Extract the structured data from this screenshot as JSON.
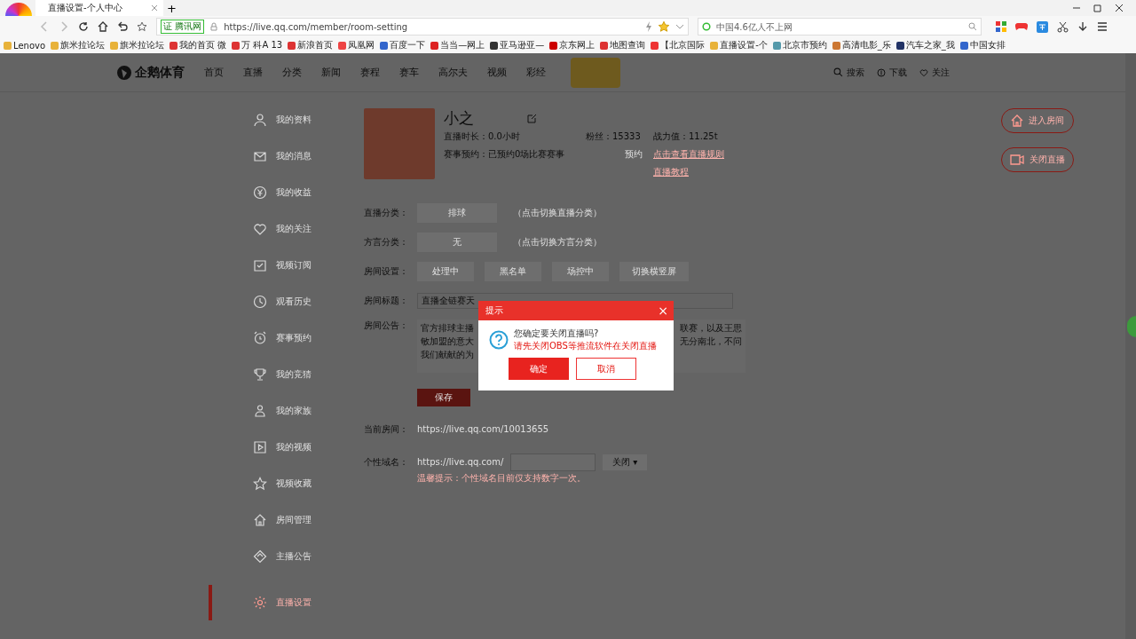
{
  "browser": {
    "tab": {
      "title": "直播设置-个人中心",
      "selected": true
    },
    "new_tab": "+",
    "badge": "证 腾讯网",
    "url": "https://live.qq.com/member/room-setting",
    "search_placeholder": "中国4.6亿人不上网",
    "bookmarks": [
      "Lenovo",
      "旗米拉论坛",
      "旗米拉论坛",
      "我的首页 微",
      "万 科A 13",
      "新浪首页",
      "凤凰网",
      "百度一下",
      "当当—网上",
      "亚马逊亚—",
      "京东网上",
      "地图查询",
      "【北京国际",
      "直播设置-个",
      "北京市预约",
      "高清电影_乐",
      "汽车之家_我",
      "中国女排"
    ]
  },
  "header": {
    "logo": "企鹅体育",
    "nav": [
      "首页",
      "直播",
      "分类",
      "新闻",
      "赛程",
      "赛车",
      "高尔夫",
      "视频",
      "彩经"
    ],
    "search": "搜索",
    "download": "下载",
    "follow": "关注"
  },
  "sidebar": [
    {
      "label": "我的资料",
      "selected": false
    },
    {
      "label": "我的消息",
      "selected": false
    },
    {
      "label": "我的收益",
      "selected": false
    },
    {
      "label": "我的关注",
      "selected": false
    },
    {
      "label": "视频订阅",
      "selected": false
    },
    {
      "label": "观看历史",
      "selected": false
    },
    {
      "label": "赛事预约",
      "selected": false
    },
    {
      "label": "我的竞猜",
      "selected": false
    },
    {
      "label": "我的家族",
      "selected": false
    },
    {
      "label": "我的视频",
      "selected": false
    },
    {
      "label": "视频收藏",
      "selected": false
    },
    {
      "label": "房间管理",
      "selected": false
    },
    {
      "label": "主播公告",
      "selected": false
    },
    {
      "label": "直播设置",
      "selected": true
    }
  ],
  "profile": {
    "name": "小之",
    "duration": "直播时长：0.0小时",
    "fans": "粉丝：15333",
    "power": "战力值：11.25t",
    "booking": "赛事预约：已预约0场比赛赛事",
    "booking_link": "预约",
    "rules_link": "点击查看直播规则",
    "tutorial_link": "直播教程"
  },
  "actions": [
    "进入房间",
    "关闭直播"
  ],
  "form": {
    "category": {
      "label": "直播分类：",
      "value": "排球",
      "hint": "（点击切换直播分类）"
    },
    "dialect": {
      "label": "方言分类：",
      "value": "无",
      "hint": "（点击切换方言分类）"
    },
    "room_settings": {
      "label": "房间设置：",
      "options": [
        "处理中",
        "黑名单",
        "场控中",
        "切换横竖屏"
      ]
    },
    "title": {
      "label": "房间标题：",
      "value": "直播全链赛天"
    },
    "notice": {
      "label": "房间公告：",
      "left": [
        "官方排球主播",
        "敏加盟的意大",
        "我们献献的为"
      ],
      "right": [
        "联赛，以及王思",
        "无分南北，不问"
      ]
    },
    "save": "保存",
    "current_room": {
      "label": "当前房间：",
      "value": "https://live.qq.com/10013655"
    },
    "custom_domain": {
      "label": "个性域名：",
      "prefix": "https://live.qq.com/",
      "status": "关闭",
      "caret": "▾",
      "hint": "温馨提示：个性域名目前仅支持数字一次。"
    }
  },
  "dialog": {
    "title": "提示",
    "close": "×",
    "question": "您确定要关闭直播吗?",
    "warning": "请先关闭OBS等推流软件在关闭直播",
    "confirm": "确定",
    "cancel": "取消"
  }
}
